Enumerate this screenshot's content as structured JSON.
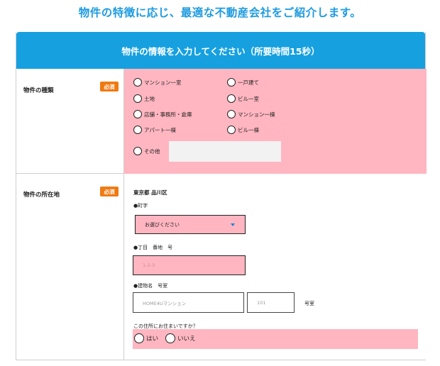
{
  "headline": "物件の特徴に応じ、最適な不動産会社をご紹介します。",
  "form": {
    "header": "物件の情報を入力してください（所要時間15秒）",
    "required_badge": "必須",
    "type_row": {
      "label": "物件の種類",
      "options": [
        "マンション一室",
        "一戸建て",
        "土地",
        "ビル一室",
        "店舗・事務所・倉庫",
        "マンション一棟",
        "アパート一棟",
        "ビル一棟",
        "その他"
      ],
      "other_value": ""
    },
    "location_row": {
      "label": "物件の所在地",
      "prefecture_city": "東京都 品川区",
      "town_label": "●町字",
      "town_select": "お選びください",
      "chome_label": "●丁目　番地　号",
      "chome_placeholder": "1-2-3",
      "building_label": "●建物名　号室",
      "building_placeholder": "HOME4Uマンション",
      "room_placeholder": "101",
      "room_unit": "号室",
      "live_question": "この住所にお住まいですか？",
      "live_yes": "はい",
      "live_no": "いいえ"
    }
  },
  "colors": {
    "accent": "#16a0e0",
    "required": "#f07a12",
    "highlight": "#ffb6c1"
  }
}
